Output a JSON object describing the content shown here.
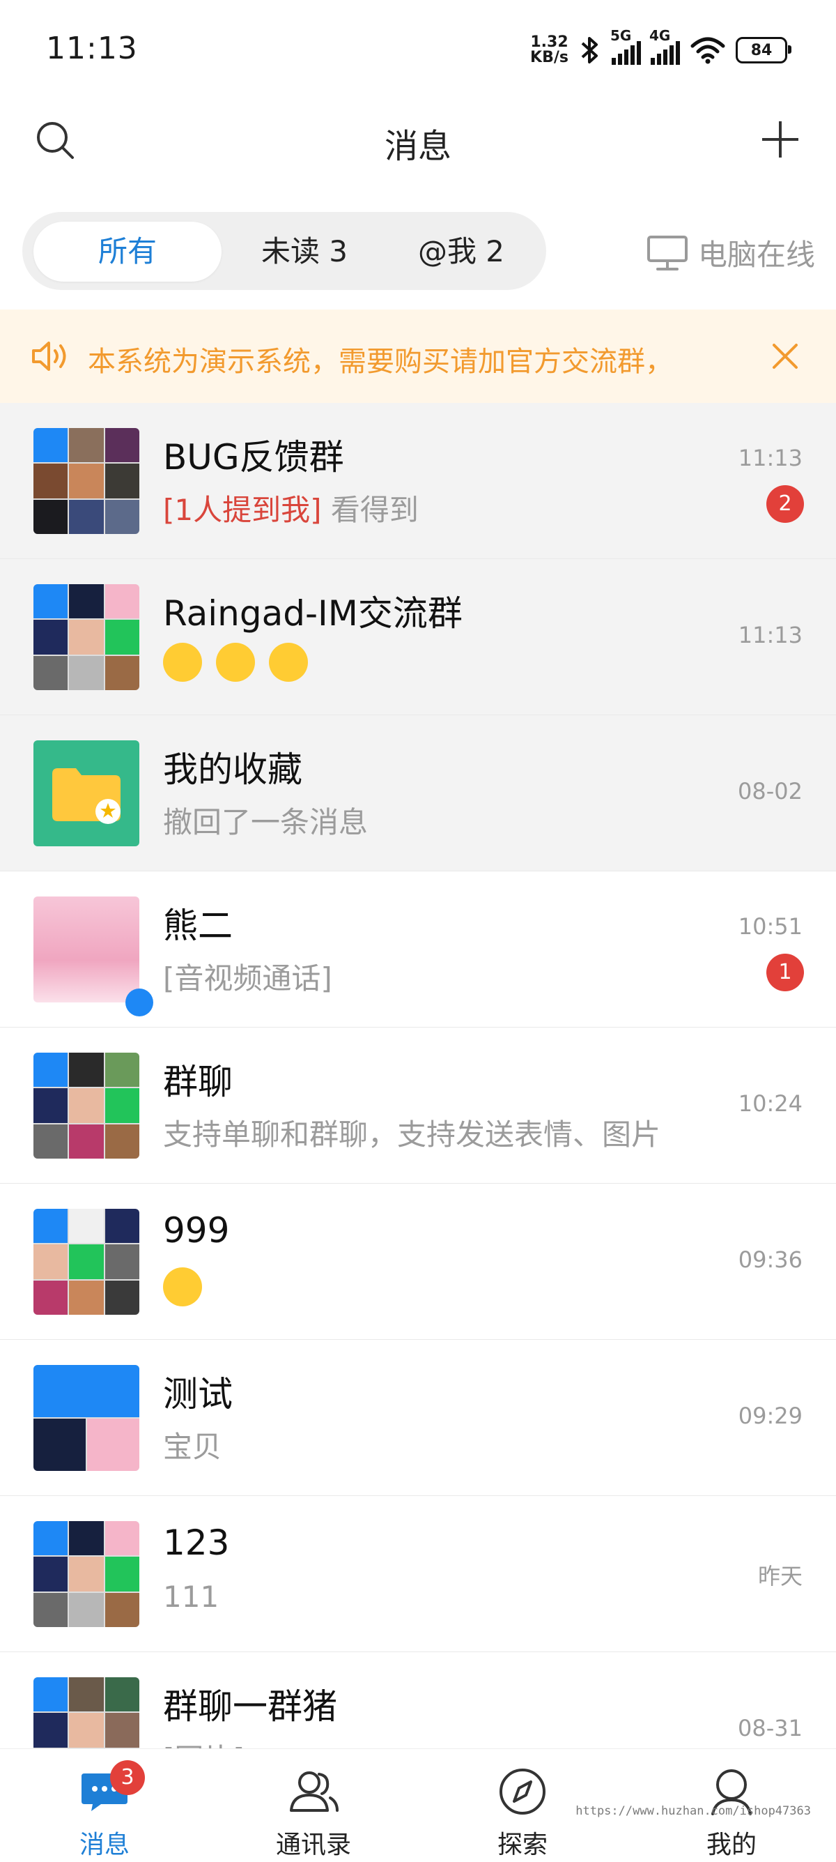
{
  "status_bar": {
    "time": "11:13",
    "net_speed_value": "1.32",
    "net_speed_unit": "KB/s",
    "signal1_label": "5G",
    "signal2_label": "4G",
    "battery": "84"
  },
  "header": {
    "title": "消息"
  },
  "filters": {
    "all": "所有",
    "unread": "未读 3",
    "mention": "@我 2",
    "pc_online": "电脑在线"
  },
  "notice": {
    "text": "本系统为演示系统，需要购买请加官方交流群，"
  },
  "chats": [
    {
      "name": "BUG反馈群",
      "mention_tag": "[1人提到我]",
      "preview": "看得到",
      "time": "11:13",
      "badge": "2"
    },
    {
      "name": "Raingad-IM交流群",
      "preview": "",
      "time": "11:13",
      "badge": ""
    },
    {
      "name": "我的收藏",
      "preview": "撤回了一条消息",
      "time": "08-02",
      "badge": ""
    },
    {
      "name": "熊二",
      "preview": "[音视频通话]",
      "time": "10:51",
      "badge": "1"
    },
    {
      "name": "群聊",
      "preview": "支持单聊和群聊，支持发送表情、图片",
      "time": "10:24",
      "badge": ""
    },
    {
      "name": "999",
      "preview": "",
      "time": "09:36",
      "badge": ""
    },
    {
      "name": "测试",
      "preview": "宝贝",
      "time": "09:29",
      "badge": ""
    },
    {
      "name": "123",
      "preview": "111",
      "time": "昨天",
      "badge": ""
    },
    {
      "name": "群聊一群猪",
      "preview": "[图片]",
      "time": "08-31",
      "badge": ""
    }
  ],
  "bottom_nav": {
    "messages": "消息",
    "messages_badge": "3",
    "contacts": "通讯录",
    "explore": "探索",
    "me": "我的"
  },
  "watermark": "https://www.huzhan.com/ishop47363",
  "colors": {
    "accent": "#1e7fd6",
    "badge": "#e2403a",
    "notice_text": "#f29a2e",
    "notice_bg": "#fff6e8",
    "favorite_bg": "#35b98a"
  }
}
